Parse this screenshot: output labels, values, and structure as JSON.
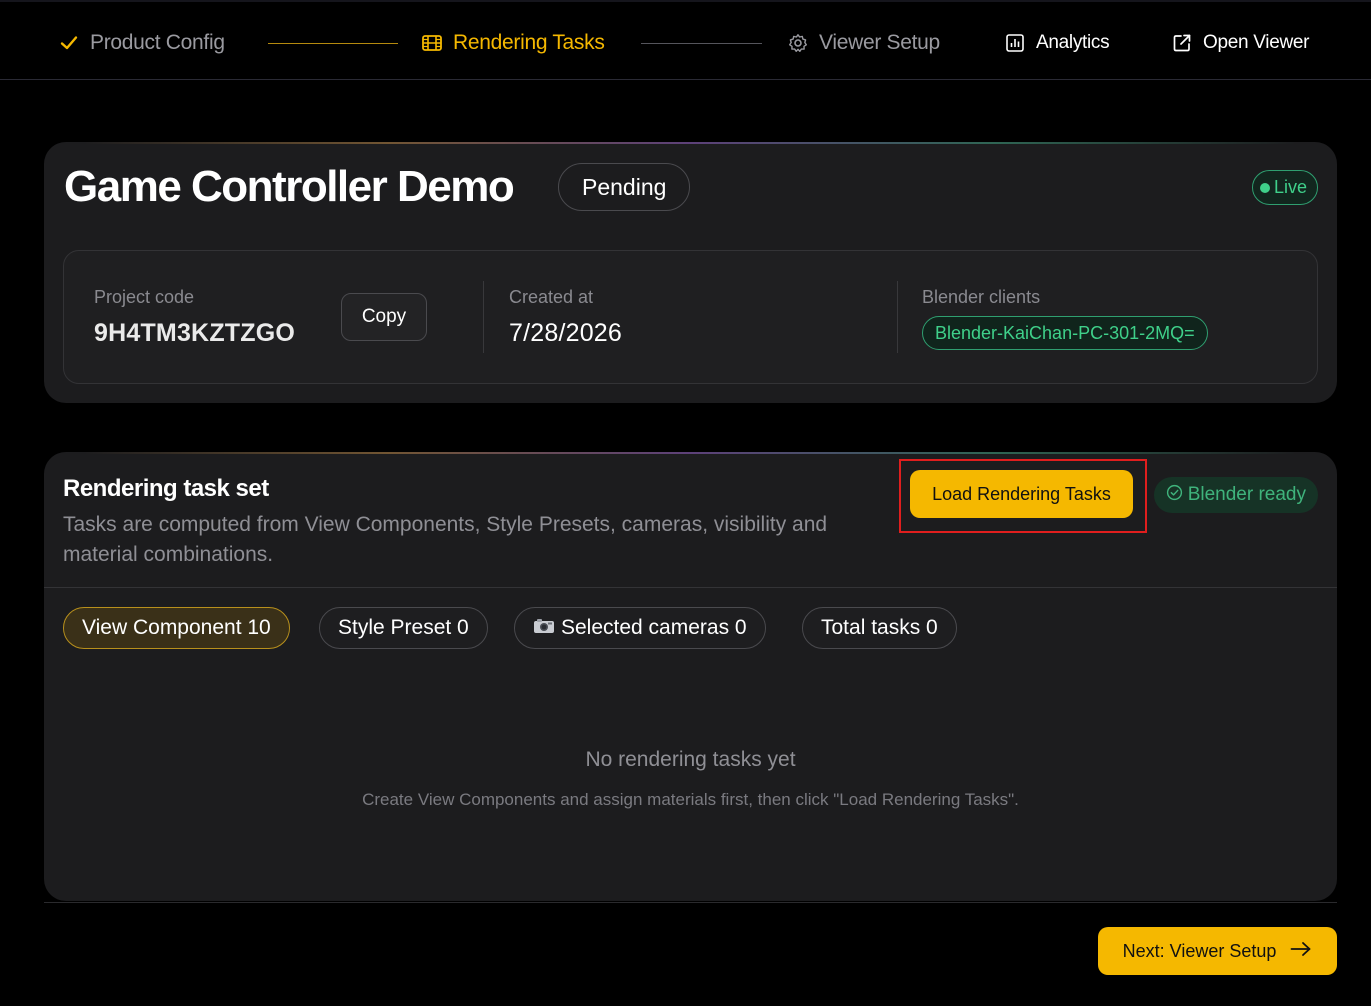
{
  "nav": {
    "steps": [
      {
        "label": "Product Config",
        "state": "done",
        "icon": "check-icon"
      },
      {
        "label": "Rendering Tasks",
        "state": "active",
        "icon": "film-icon"
      },
      {
        "label": "Viewer Setup",
        "state": "pending",
        "icon": "gear-icon"
      }
    ],
    "links": [
      {
        "label": "Analytics",
        "icon": "bar-chart-icon"
      },
      {
        "label": "Open Viewer",
        "icon": "external-link-icon"
      }
    ]
  },
  "project": {
    "title": "Game Controller Demo",
    "status": "Pending",
    "live_label": "Live",
    "code_label": "Project code",
    "code_value": "9H4TM3KZTZGO",
    "copy_label": "Copy",
    "created_label": "Created at",
    "created_value": "7/28/2026",
    "clients_label": "Blender clients",
    "clients": [
      "Blender-KaiChan-PC-301-2MQ="
    ]
  },
  "tasks": {
    "title": "Rendering task set",
    "description": "Tasks are computed from View Components, Style Presets, cameras, visibility and material combinations.",
    "load_button": "Load Rendering Tasks",
    "ready_label": "Blender ready",
    "chips": [
      {
        "label": "View Component 10",
        "active": true
      },
      {
        "label": "Style Preset 0",
        "active": false
      },
      {
        "label": "Selected cameras 0",
        "active": false,
        "icon": "camera-icon"
      },
      {
        "label": "Total tasks 0",
        "active": false
      }
    ],
    "empty_title": "No rendering tasks yet",
    "empty_subtitle": "Create View Components and assign materials first, then click \"Load Rendering Tasks\"."
  },
  "footer": {
    "next_button": "Next: Viewer Setup"
  },
  "colors": {
    "accent": "#f5b800",
    "success": "#3fd08a",
    "highlight": "#e01e1e"
  }
}
